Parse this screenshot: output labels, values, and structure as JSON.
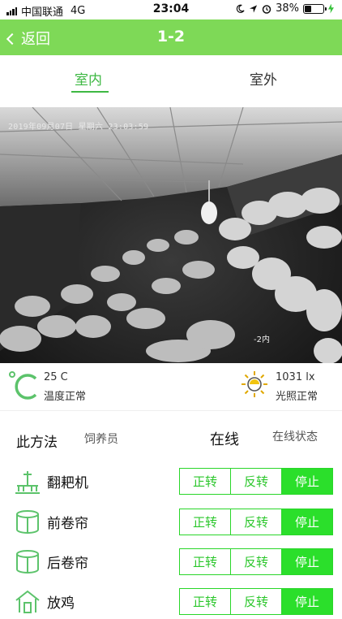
{
  "status_bar": {
    "carrier": "中国联通",
    "network": "4G",
    "time": "23:04",
    "battery_percent_text": "38%",
    "battery_level": 0.38,
    "icons": [
      "moon-icon",
      "location-icon",
      "alarm-icon",
      "charging-icon"
    ]
  },
  "nav": {
    "back_label": "返回",
    "title": "1-2",
    "bar_color": "#7ed957"
  },
  "tabs": [
    {
      "label": "室内",
      "selected": true
    },
    {
      "label": "室外",
      "selected": false
    }
  ],
  "camera": {
    "timestamp": "2019年09月07日  星期六  23:03:59",
    "channel_tag": "-2内"
  },
  "sensors": {
    "temperature": {
      "value": "25 C",
      "status": "温度正常",
      "icon": "celsius-icon"
    },
    "light": {
      "value": "1031 lx",
      "status": "光照正常",
      "icon": "sun-icon"
    }
  },
  "info": {
    "method_label": "此方法",
    "keeper_label": "饲养员",
    "online_label": "在线",
    "status_label": "在线状态"
  },
  "devices": [
    {
      "name": "翻耙机",
      "icon": "tiller-icon",
      "forward": "正转",
      "reverse": "反转",
      "stop": "停止",
      "active": "stop"
    },
    {
      "name": "前卷帘",
      "icon": "curtain-roll-icon",
      "forward": "正转",
      "reverse": "反转",
      "stop": "停止",
      "active": "stop"
    },
    {
      "name": "后卷帘",
      "icon": "curtain-roll-icon",
      "forward": "正转",
      "reverse": "反转",
      "stop": "停止",
      "active": "stop"
    },
    {
      "name": "放鸡",
      "icon": "coop-icon",
      "forward": "正转",
      "reverse": "反转",
      "stop": "停止",
      "active": "stop"
    }
  ],
  "colors": {
    "accent_green": "#3eb843",
    "button_green": "#2bdf2b",
    "icon_green": "#5cc36b"
  }
}
